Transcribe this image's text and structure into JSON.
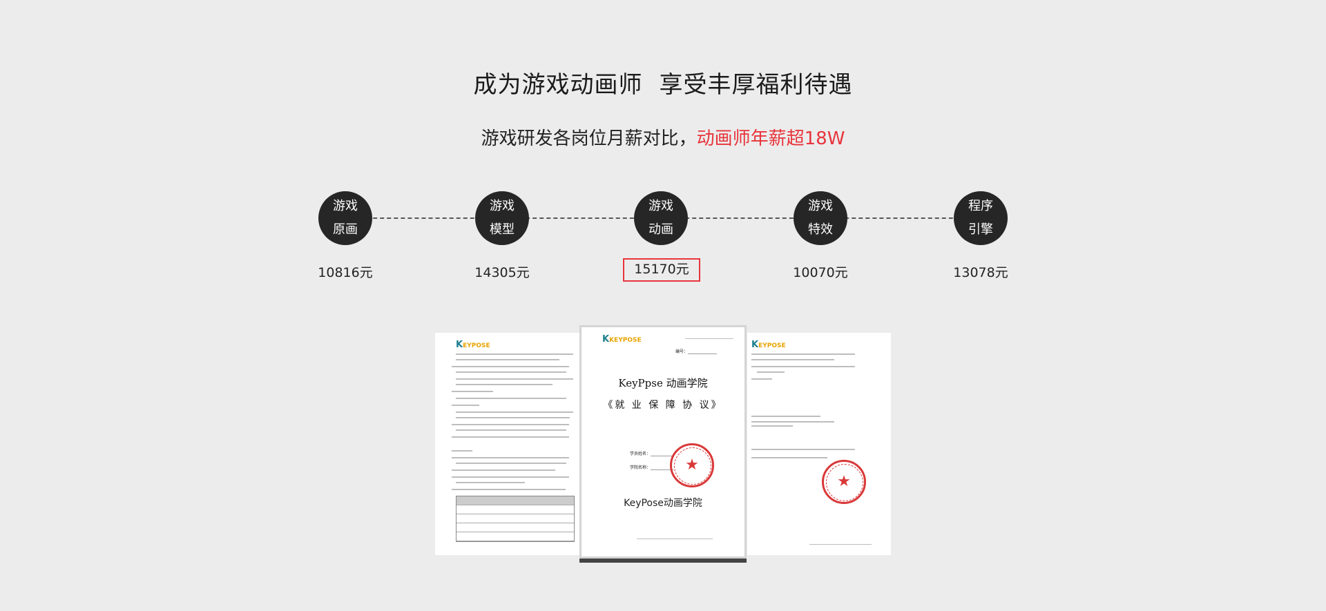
{
  "header": {
    "title_part1": "成为游戏动画师",
    "title_part2": "享受丰厚福利待遇",
    "subtitle_plain": "游戏研发各岗位月薪对比，",
    "subtitle_highlight": "动画师年薪超18W",
    "highlight_color": "#e8343b"
  },
  "roles": [
    {
      "line1": "游戏",
      "line2": "原画",
      "salary": "10816元"
    },
    {
      "line1": "游戏",
      "line2": "模型",
      "salary": "14305元"
    },
    {
      "line1": "游戏",
      "line2": "动画",
      "salary": "15170元",
      "highlighted": true
    },
    {
      "line1": "游戏",
      "line2": "特效",
      "salary": "10070元"
    },
    {
      "line1": "程序",
      "line2": "引擎",
      "salary": "13078元"
    }
  ],
  "document": {
    "logo_text": "KEYPOSE",
    "title_line1": "KeyPpse 动画学院",
    "title_line2": "《就 业 保 障 协 议》",
    "number_label": "编号：",
    "field_student_name": "学员姓名：",
    "field_student_school": "学院名称：",
    "bottom_text": "KeyPose动画学院"
  }
}
